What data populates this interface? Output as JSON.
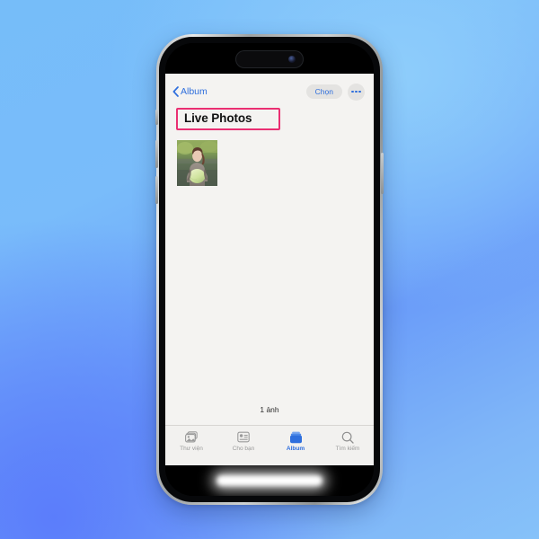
{
  "device": {
    "name": "iphone-15-pro",
    "frame_color": "#b9bcbd",
    "screen_background": "#f4f3f1"
  },
  "backdrop": {
    "gradient_from": "#86c2f9",
    "gradient_to": "#5b7dfb"
  },
  "navbar": {
    "back_label": "Album",
    "back_icon": "chevron-left-icon",
    "select_label": "Chọn",
    "more_icon": "ellipsis-icon",
    "accent_color": "#2f6fdd"
  },
  "header": {
    "album_title": "Live Photos",
    "highlight_color": "#ea2f72"
  },
  "grid": {
    "photos": [
      {
        "alt": "woman-in-taupe-top-outdoors",
        "name": "photo-thumbnail-1"
      }
    ]
  },
  "footer": {
    "count_label": "1 ảnh"
  },
  "tabbar": {
    "items": [
      {
        "label": "Thư viện",
        "icon": "photo-stack-icon",
        "active": false
      },
      {
        "label": "Cho bạn",
        "icon": "for-you-card-icon",
        "active": false
      },
      {
        "label": "Album",
        "icon": "albums-icon",
        "active": true
      },
      {
        "label": "Tìm kiếm",
        "icon": "search-icon",
        "active": false
      }
    ],
    "active_color": "#2f6fdd",
    "inactive_color": "#9a9a9a"
  }
}
